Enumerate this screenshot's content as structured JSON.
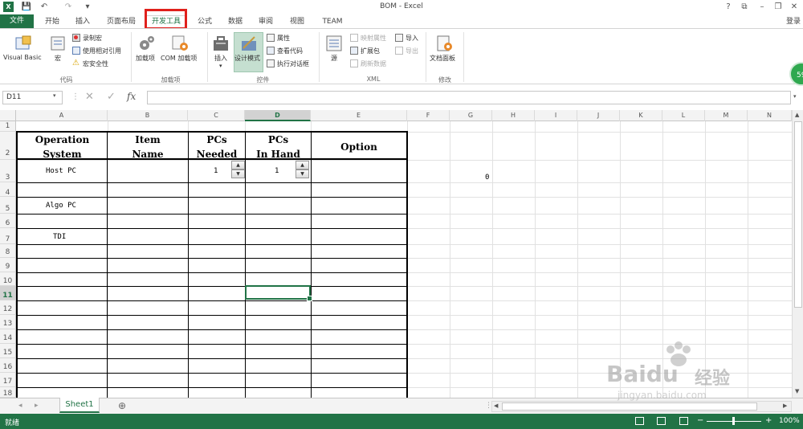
{
  "window": {
    "title": "BOM - Excel",
    "signin": "登录"
  },
  "qat": {
    "save": "💾",
    "undo": "↶",
    "redo": "↷",
    "more": "▾"
  },
  "tabs": [
    "文件",
    "开始",
    "插入",
    "页面布局",
    "开发工具",
    "公式",
    "数据",
    "审阅",
    "视图",
    "TEAM"
  ],
  "ribbon": {
    "code": {
      "visual_basic": "Visual Basic",
      "macro": "宏",
      "record_macro": "录制宏",
      "relative_ref": "使用相对引用",
      "macro_security": "宏安全性",
      "group": "代码"
    },
    "addins": {
      "addins": "加载项",
      "com_addins": "COM 加载项",
      "group": "加载项"
    },
    "controls": {
      "insert": "插入",
      "design_mode": "设计模式",
      "properties": "属性",
      "view_code": "查看代码",
      "run_dialog": "执行对话框",
      "group": "控件"
    },
    "xml": {
      "source": "源",
      "map_props": "映射属性",
      "expansion_packs": "扩展包",
      "refresh_data": "刷新数据",
      "import": "导入",
      "export": "导出",
      "group": "XML"
    },
    "modify": {
      "doc_panel": "文档面板",
      "group": "修改"
    }
  },
  "formula_bar": {
    "name_box": "D11",
    "fx": "fx",
    "cancel": "✕",
    "enter": "✓",
    "formula": ""
  },
  "columns": [
    "A",
    "B",
    "C",
    "D",
    "E",
    "F",
    "G",
    "H",
    "I",
    "J",
    "K",
    "L",
    "M",
    "N"
  ],
  "rows": [
    "1",
    "2",
    "3",
    "4",
    "5",
    "6",
    "7",
    "8",
    "9",
    "10",
    "11",
    "12",
    "13",
    "14",
    "15",
    "16",
    "17",
    "18"
  ],
  "table": {
    "headers": {
      "a1": "Operation",
      "a2": "System",
      "b1": "Item",
      "b2": "Name",
      "c1": "PCs",
      "c2": "Needed",
      "d1": "PCs",
      "d2": "In Hand",
      "e1": "Option"
    },
    "cells": {
      "a3": "Host PC",
      "c3": "1",
      "d3": "1",
      "g3": "0",
      "a5": "Algo PC",
      "a7": "TDI"
    }
  },
  "sheet_tabs": {
    "active": "Sheet1",
    "add": "⊕",
    "prev": "◂",
    "next": "▸"
  },
  "status": {
    "mode": "就绪",
    "zoom": "100%",
    "zoom_minus": "−",
    "zoom_plus": "+"
  },
  "badge": "59",
  "watermark": {
    "brand": "Baidu",
    "suffix": "经验",
    "url": "jingyan.baidu.com"
  }
}
